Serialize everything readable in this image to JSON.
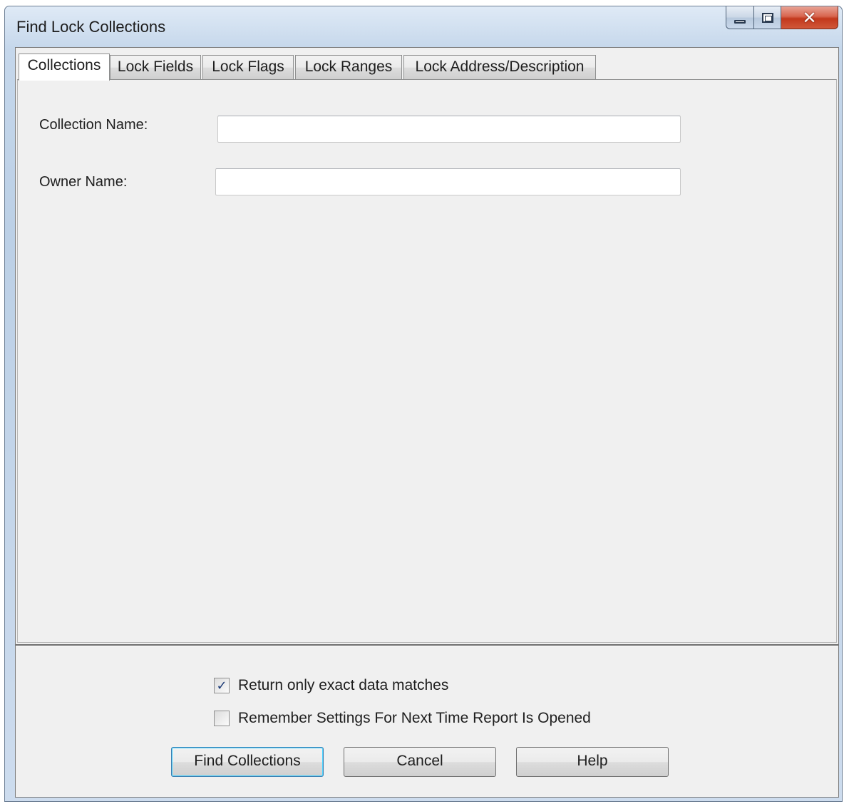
{
  "window": {
    "title": "Find Lock Collections"
  },
  "tabs": [
    {
      "label": "Collections",
      "active": true
    },
    {
      "label": "Lock Fields",
      "active": false
    },
    {
      "label": "Lock Flags",
      "active": false
    },
    {
      "label": "Lock Ranges",
      "active": false
    },
    {
      "label": "Lock Address/Description",
      "active": false
    }
  ],
  "form": {
    "collection_name_label": "Collection Name:",
    "collection_name_value": "",
    "owner_name_label": "Owner Name:",
    "owner_name_value": ""
  },
  "options": {
    "exact_match_label": "Return only exact data matches",
    "exact_match_checked": true,
    "remember_label": "Remember Settings For Next Time Report Is Opened",
    "remember_checked": false
  },
  "buttons": {
    "find_label": "Find Collections",
    "cancel_label": "Cancel",
    "help_label": "Help"
  },
  "colors": {
    "close_button": "#c2381c",
    "dialog_background": "#f0f0f0",
    "check_mark": "#1f3d78"
  },
  "icons": {
    "minimize": "minimize-icon",
    "maximize": "maximize-icon",
    "close": "close-icon",
    "check": "check-icon"
  }
}
